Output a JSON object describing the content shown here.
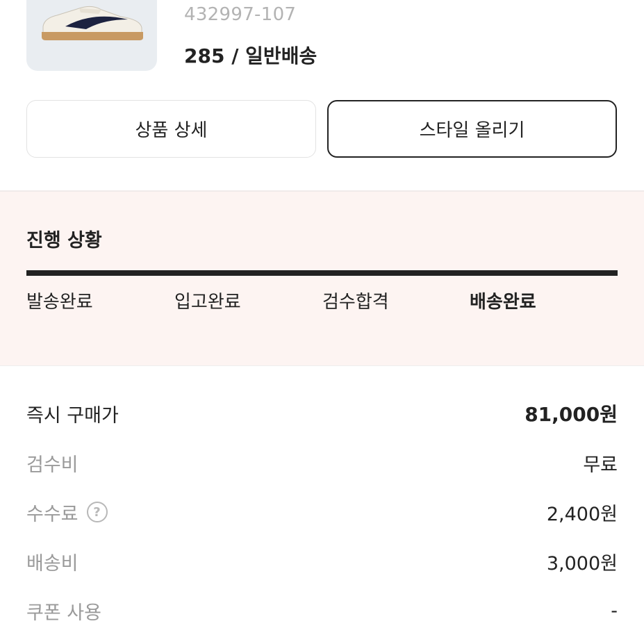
{
  "product": {
    "image_icon": "sneaker-image",
    "model_number": "432997-107",
    "size_shipping": "285 / 일반배송"
  },
  "actions": {
    "detail_label": "상품 상세",
    "style_label": "스타일 올리기"
  },
  "progress": {
    "title": "진행 상황",
    "completed_fraction": 1.0,
    "steps": [
      {
        "label": "발송완료",
        "active": false
      },
      {
        "label": "입고완료",
        "active": false
      },
      {
        "label": "검수합격",
        "active": false
      },
      {
        "label": "배송완료",
        "active": true
      }
    ]
  },
  "pricing": {
    "rows": [
      {
        "label": "즉시 구매가",
        "value": "81,000원"
      },
      {
        "label": "검수비",
        "value": "무료"
      },
      {
        "label": "수수료",
        "value": "2,400원",
        "help_icon": "question-circle-icon"
      },
      {
        "label": "배송비",
        "value": "3,000원"
      },
      {
        "label": "쿠폰 사용",
        "value": "-"
      }
    ]
  },
  "colors": {
    "progress_background": "#fdf4f2",
    "accent": "#222222"
  }
}
